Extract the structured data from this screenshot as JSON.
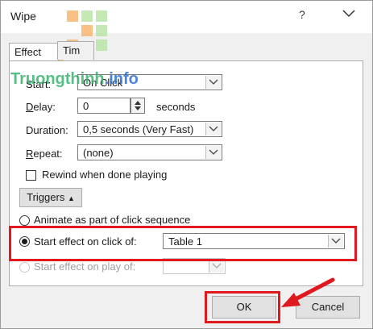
{
  "window": {
    "title": "Wipe",
    "help_label": "?"
  },
  "tabs": [
    {
      "label": "Effect"
    },
    {
      "label": "Tim"
    }
  ],
  "watermark": {
    "part1": "Truongthinh",
    "part2": ".info"
  },
  "form": {
    "start": {
      "label": "Start:",
      "value": "On Click"
    },
    "delay": {
      "label": "Delay:",
      "value": "0",
      "unit": "seconds"
    },
    "duration": {
      "label": "Duration:",
      "value": "0,5 seconds (Very Fast)"
    },
    "repeat": {
      "label": "Repeat:",
      "value": "(none)"
    },
    "rewind": {
      "label": "Rewind when done playing",
      "checked": false
    }
  },
  "triggers": {
    "button_label": "Triggers",
    "animate_option": "Animate as part of click sequence",
    "start_on_click_label": "Start effect on click of:",
    "start_on_click_value": "Table 1",
    "start_on_play_label": "Start effect on play of:",
    "selected": "start_on_click"
  },
  "footer": {
    "ok_label": "OK",
    "cancel_label": "Cancel"
  },
  "colors": {
    "highlight": "#e0191e",
    "watermark_green": "#3cb371",
    "watermark_blue": "#2f6fd6"
  }
}
